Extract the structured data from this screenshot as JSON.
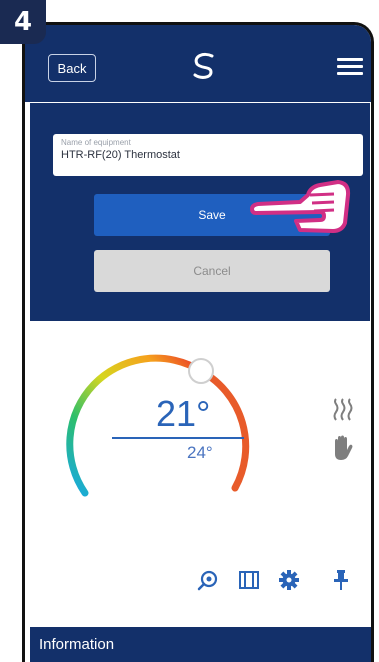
{
  "step": {
    "number": "4"
  },
  "header": {
    "back_label": "Back",
    "logo_icon": "logo-icon",
    "menu_icon": "hamburger-menu-icon"
  },
  "form": {
    "name_label": "Name of equipment",
    "name_value": "HTR-RF(20) Thermostat",
    "save_label": "Save",
    "cancel_label": "Cancel"
  },
  "thermostat": {
    "current_temp": "21°",
    "set_temp": "24°",
    "status_icons": [
      "heating-icon",
      "manual-mode-hand-icon"
    ],
    "toolbar_icons": [
      "view-icon",
      "schedule-icon",
      "settings-gear-icon",
      "pin-icon"
    ]
  },
  "info": {
    "label": "Information"
  },
  "colors": {
    "primary": "#13306a",
    "save_button": "#1f5fbf",
    "cancel_button": "#d9d9d9",
    "temp_text": "#2a64b8"
  }
}
